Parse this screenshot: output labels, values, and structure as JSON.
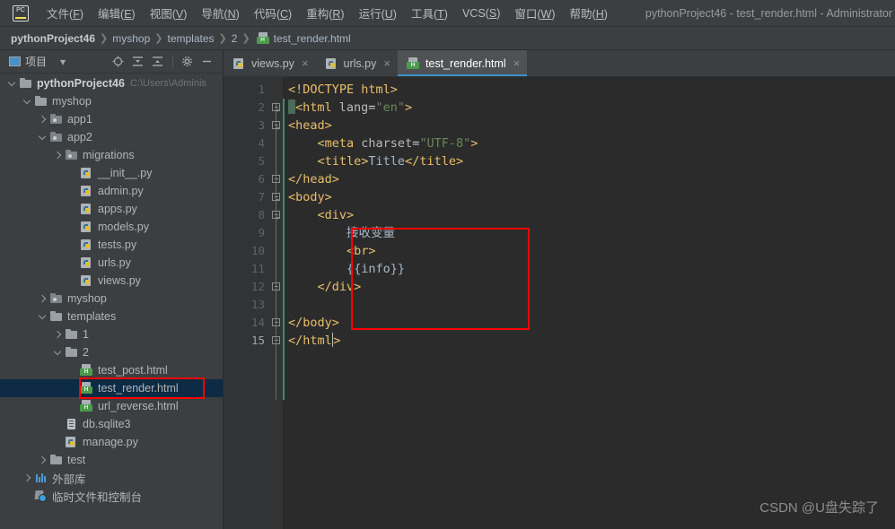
{
  "window": {
    "title": "pythonProject46 - test_render.html - Administrator"
  },
  "menubar": {
    "logo": "PC",
    "items": [
      {
        "label": "文件",
        "mnemonic": "F"
      },
      {
        "label": "编辑",
        "mnemonic": "E"
      },
      {
        "label": "视图",
        "mnemonic": "V"
      },
      {
        "label": "导航",
        "mnemonic": "N"
      },
      {
        "label": "代码",
        "mnemonic": "C"
      },
      {
        "label": "重构",
        "mnemonic": "R"
      },
      {
        "label": "运行",
        "mnemonic": "U"
      },
      {
        "label": "工具",
        "mnemonic": "T"
      },
      {
        "label": "VCS",
        "mnemonic": "S"
      },
      {
        "label": "窗口",
        "mnemonic": "W"
      },
      {
        "label": "帮助",
        "mnemonic": "H"
      }
    ]
  },
  "breadcrumb": {
    "items": [
      "pythonProject46",
      "myshop",
      "templates",
      "2",
      "test_render.html"
    ]
  },
  "sidebar": {
    "toolbar": {
      "title": "项目",
      "icons": [
        "project-icon",
        "chevron-down-icon",
        "locate-icon",
        "expand-all-icon",
        "collapse-all-icon",
        "gear-icon",
        "minimize-icon"
      ]
    },
    "tree": [
      {
        "label": "pythonProject46",
        "path": "C:\\Users\\Adminis",
        "indent": 0,
        "arrow": "down",
        "icon": "folder",
        "bold": true
      },
      {
        "label": "myshop",
        "indent": 1,
        "arrow": "down",
        "icon": "folder"
      },
      {
        "label": "app1",
        "indent": 2,
        "arrow": "right",
        "icon": "folder-module"
      },
      {
        "label": "app2",
        "indent": 2,
        "arrow": "down",
        "icon": "folder-module"
      },
      {
        "label": "migrations",
        "indent": 3,
        "arrow": "right",
        "icon": "folder-module"
      },
      {
        "label": "__init__.py",
        "indent": 4,
        "arrow": "none",
        "icon": "python"
      },
      {
        "label": "admin.py",
        "indent": 4,
        "arrow": "none",
        "icon": "python"
      },
      {
        "label": "apps.py",
        "indent": 4,
        "arrow": "none",
        "icon": "python"
      },
      {
        "label": "models.py",
        "indent": 4,
        "arrow": "none",
        "icon": "python"
      },
      {
        "label": "tests.py",
        "indent": 4,
        "arrow": "none",
        "icon": "python"
      },
      {
        "label": "urls.py",
        "indent": 4,
        "arrow": "none",
        "icon": "python"
      },
      {
        "label": "views.py",
        "indent": 4,
        "arrow": "none",
        "icon": "python"
      },
      {
        "label": "myshop",
        "indent": 2,
        "arrow": "right",
        "icon": "folder-module"
      },
      {
        "label": "templates",
        "indent": 2,
        "arrow": "down",
        "icon": "folder"
      },
      {
        "label": "1",
        "indent": 3,
        "arrow": "right",
        "icon": "folder"
      },
      {
        "label": "2",
        "indent": 3,
        "arrow": "down",
        "icon": "folder"
      },
      {
        "label": "test_post.html",
        "indent": 4,
        "arrow": "none",
        "icon": "html"
      },
      {
        "label": "test_render.html",
        "indent": 4,
        "arrow": "none",
        "icon": "html",
        "selected": true,
        "highlighted": true
      },
      {
        "label": "url_reverse.html",
        "indent": 4,
        "arrow": "none",
        "icon": "html"
      },
      {
        "label": "db.sqlite3",
        "indent": 3,
        "arrow": "none",
        "icon": "db"
      },
      {
        "label": "manage.py",
        "indent": 3,
        "arrow": "none",
        "icon": "python"
      },
      {
        "label": "test",
        "indent": 2,
        "arrow": "right",
        "icon": "folder"
      },
      {
        "label": "外部库",
        "indent": 1,
        "arrow": "right",
        "icon": "library"
      },
      {
        "label": "临时文件和控制台",
        "indent": 1,
        "arrow": "none",
        "icon": "scratch"
      }
    ]
  },
  "editor": {
    "tabs": [
      {
        "label": "views.py",
        "icon": "python",
        "active": false,
        "close": "×"
      },
      {
        "label": "urls.py",
        "icon": "python",
        "active": false,
        "close": "×"
      },
      {
        "label": "test_render.html",
        "icon": "html",
        "active": true,
        "close": "×"
      }
    ],
    "line_numbers": [
      "1",
      "2",
      "3",
      "4",
      "5",
      "6",
      "7",
      "8",
      "9",
      "10",
      "11",
      "12",
      "13",
      "14",
      "15"
    ],
    "current_line": 15,
    "lines": [
      {
        "n": 1,
        "text": "<!DOCTYPE html>"
      },
      {
        "n": 2,
        "text": "<html lang=\"en\">"
      },
      {
        "n": 3,
        "text": "<head>"
      },
      {
        "n": 4,
        "text": "    <meta charset=\"UTF-8\">"
      },
      {
        "n": 5,
        "text": "    <title>Title</title>"
      },
      {
        "n": 6,
        "text": "</head>"
      },
      {
        "n": 7,
        "text": "<body>"
      },
      {
        "n": 8,
        "text": "    <div>"
      },
      {
        "n": 9,
        "text": "        接收变量"
      },
      {
        "n": 10,
        "text": "        <br>"
      },
      {
        "n": 11,
        "text": "        {{info}}"
      },
      {
        "n": 12,
        "text": "    </div>"
      },
      {
        "n": 13,
        "text": ""
      },
      {
        "n": 14,
        "text": "</body>"
      },
      {
        "n": 15,
        "text": "</html>"
      }
    ]
  },
  "annotations": {
    "code_box_label": "highlighted-div-block",
    "tree_box_label": "highlighted-selected-file",
    "box_color": "#ff0000"
  },
  "watermark": {
    "text": "CSDN @U盘失踪了"
  },
  "colors": {
    "chrome_bg": "#3c3f41",
    "editor_bg": "#2b2b2b",
    "gutter_bg": "#313335",
    "selection_bg": "#0d2b45",
    "tab_active_bg": "#4e5254",
    "tab_underline": "#3d8ec9",
    "tag": "#e8bf6a",
    "string": "#6a8759",
    "text": "#a9b7c6",
    "template_var": "#9876aa",
    "annotation_red": "#ff0000"
  }
}
